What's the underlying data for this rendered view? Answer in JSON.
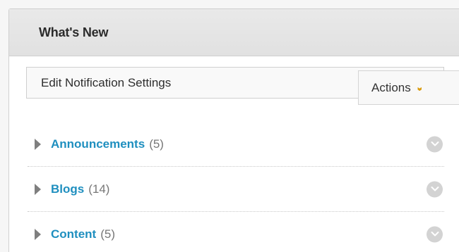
{
  "module": {
    "title": "What's New"
  },
  "toolbar": {
    "edit_label": "Edit Notification Settings",
    "actions_label": "Actions",
    "actions_icon": "double-chevron-down-icon",
    "accent_color": "#d99a0b"
  },
  "rows": [
    {
      "label": "Announcements",
      "count": "(5)",
      "icon": "chevron-down-icon"
    },
    {
      "label": "Blogs",
      "count": "(14)",
      "icon": "chevron-down-icon"
    },
    {
      "label": "Content",
      "count": "(5)",
      "icon": "chevron-down-icon"
    }
  ],
  "colors": {
    "link": "#1f8fbf",
    "count": "#777777"
  }
}
